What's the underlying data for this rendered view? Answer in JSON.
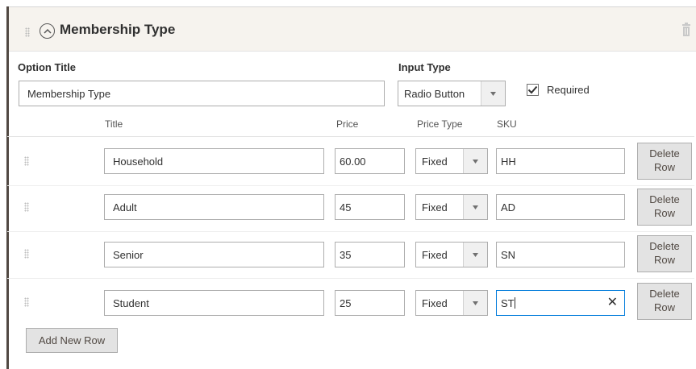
{
  "header": {
    "title": "Membership Type"
  },
  "option_title": {
    "label": "Option Title",
    "value": "Membership Type"
  },
  "input_type": {
    "label": "Input Type",
    "value": "Radio Button"
  },
  "required": {
    "label": "Required",
    "checked": true
  },
  "columns": {
    "title": "Title",
    "price": "Price",
    "price_type": "Price Type",
    "sku": "SKU"
  },
  "rows": [
    {
      "title": "Household",
      "price": "60.00",
      "price_type": "Fixed",
      "sku": "HH",
      "delete_label": "Delete Row"
    },
    {
      "title": "Adult",
      "price": "45",
      "price_type": "Fixed",
      "sku": "AD",
      "delete_label": "Delete Row"
    },
    {
      "title": "Senior",
      "price": "35",
      "price_type": "Fixed",
      "sku": "SN",
      "delete_label": "Delete Row"
    },
    {
      "title": "Student",
      "price": "25",
      "price_type": "Fixed",
      "sku": "ST",
      "delete_label": "Delete Row"
    }
  ],
  "add_row_label": "Add New Row"
}
